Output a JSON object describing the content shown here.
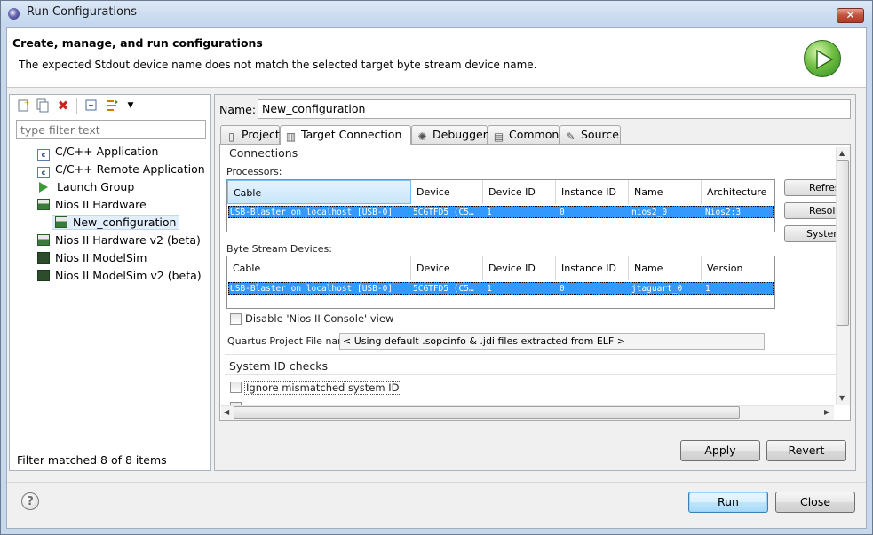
{
  "window": {
    "title": "Run Configurations",
    "close_symbol": "✕"
  },
  "banner": {
    "title": "Create, manage, and run configurations",
    "message": "The expected Stdout device name does not match the selected target byte stream device name."
  },
  "left": {
    "filter_placeholder": "type filter text",
    "tree": [
      {
        "label": "C/C++ Application",
        "icon": "c-app-icon"
      },
      {
        "label": "C/C++ Remote Application",
        "icon": "c-app-icon"
      },
      {
        "label": "Launch Group",
        "icon": "launch-group-icon"
      },
      {
        "label": "Nios II Hardware",
        "icon": "nios-hardware-icon"
      },
      {
        "label": "New_configuration",
        "icon": "nios-config-icon"
      },
      {
        "label": "Nios II Hardware v2 (beta)",
        "icon": "nios-hardware-icon"
      },
      {
        "label": "Nios II ModelSim",
        "icon": "modelsim-icon"
      },
      {
        "label": "Nios II ModelSim v2 (beta)",
        "icon": "modelsim-icon"
      }
    ],
    "status": "Filter matched 8 of 8 items"
  },
  "right": {
    "name_label": "Name:",
    "name_value": "New_configuration",
    "tabs": [
      {
        "label": "Project",
        "icon": "project-icon"
      },
      {
        "label": "Target Connection",
        "icon": "target-connection-icon"
      },
      {
        "label": "Debugger",
        "icon": "debugger-icon"
      },
      {
        "label": "Common",
        "icon": "common-icon"
      },
      {
        "label": "Source",
        "icon": "source-icon"
      }
    ],
    "active_tab": "Target Connection",
    "connections": {
      "title": "Connections",
      "processors_label": "Processors:",
      "processor_columns": [
        "Cable",
        "Device",
        "Device ID",
        "Instance ID",
        "Name",
        "Architecture"
      ],
      "processor_rows": [
        [
          "USB-Blaster on localhost [USB-0]",
          "5CGTFD5 (C5…",
          "1",
          "0",
          "nios2_0",
          "Nios2:3"
        ]
      ],
      "byte_stream_label": "Byte Stream Devices:",
      "byte_stream_columns": [
        "Cable",
        "Device",
        "Device ID",
        "Instance ID",
        "Name",
        "Version"
      ],
      "byte_stream_rows": [
        [
          "USB-Blaster on localhost [USB-0]",
          "5CGTFD5 (C5…",
          "1",
          "0",
          "jtaguart_0",
          "1"
        ]
      ],
      "side_buttons": [
        "Refresh Connections",
        "Resolve Names",
        "System ID Properties..."
      ],
      "disable_console_label": "Disable 'Nios II Console' view",
      "qpf_label": "Quartus Project File name:",
      "qpf_value": "< Using default .sopcinfo & .jdi files extracted from ELF >"
    },
    "system_id": {
      "title": "System ID checks",
      "ignore_label": "Ignore mismatched system ID"
    },
    "apply_label": "Apply",
    "revert_label": "Revert"
  },
  "footer": {
    "help_symbol": "?",
    "run_label": "Run",
    "close_label": "Close"
  }
}
